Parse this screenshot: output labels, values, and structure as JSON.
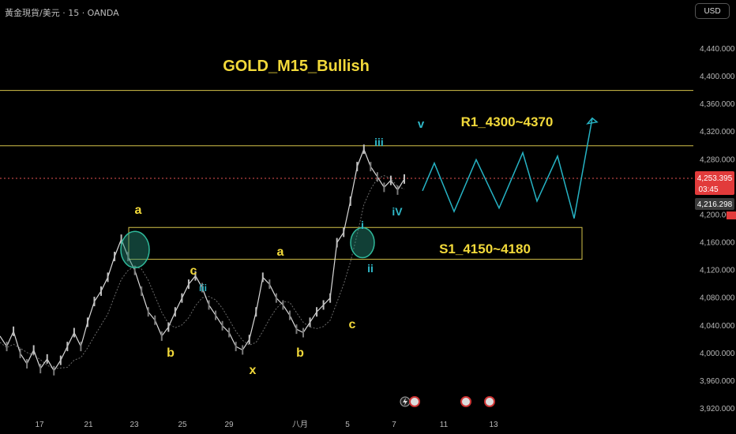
{
  "symbol": "黃金現貨/美元 · 15 · OANDA",
  "currency_button": "USD",
  "chart_data": {
    "type": "line",
    "title": "GOLD_M15_Bullish",
    "y_ticks": [
      "4,440.000",
      "4,400.000",
      "4,360.000",
      "4,320.000",
      "4,280.000",
      "4,200.000",
      "4,160.000",
      "4,120.000",
      "4,080.000",
      "4,040.000",
      "4,000.000",
      "3,960.000",
      "3,920.000"
    ],
    "x_ticks": [
      "17",
      "21",
      "23",
      "25",
      "29",
      "八月",
      "5",
      "7",
      "11",
      "13"
    ],
    "price_tag": {
      "value": "4,253.395",
      "countdown": "03:45"
    },
    "secondary_tag": "4,216.298",
    "resistance": {
      "label": "R1_4300~4370",
      "low": 4300,
      "high": 4380
    },
    "support": {
      "label": "S1_4150~4180",
      "low": 4136,
      "high": 4182
    },
    "wave_labels": {
      "a1": "a",
      "c1": "c",
      "b1": "b",
      "iii_small": "iii",
      "x": "x",
      "a2": "a",
      "b2": "b",
      "c2": "c",
      "i": "i",
      "ii": "ii",
      "iii": "iii",
      "iv": "iV",
      "v": "v"
    },
    "price_path": [
      4025,
      4010,
      4032,
      4000,
      3985,
      4005,
      3978,
      3992,
      3975,
      3990,
      4010,
      4030,
      4010,
      4045,
      4075,
      4090,
      4110,
      4140,
      4165,
      4140,
      4120,
      4090,
      4060,
      4048,
      4025,
      4038,
      4060,
      4080,
      4100,
      4112,
      4095,
      4070,
      4055,
      4040,
      4030,
      4010,
      4005,
      4020,
      4060,
      4110,
      4100,
      4080,
      4070,
      4055,
      4035,
      4030,
      4045,
      4060,
      4070,
      4080,
      4160,
      4175,
      4220,
      4270,
      4295,
      4270,
      4255,
      4240,
      4250,
      4236,
      4252
    ],
    "projection_path": [
      4235,
      4275,
      4205,
      4280,
      4210,
      4290,
      4220,
      4285,
      4195,
      4340
    ]
  }
}
